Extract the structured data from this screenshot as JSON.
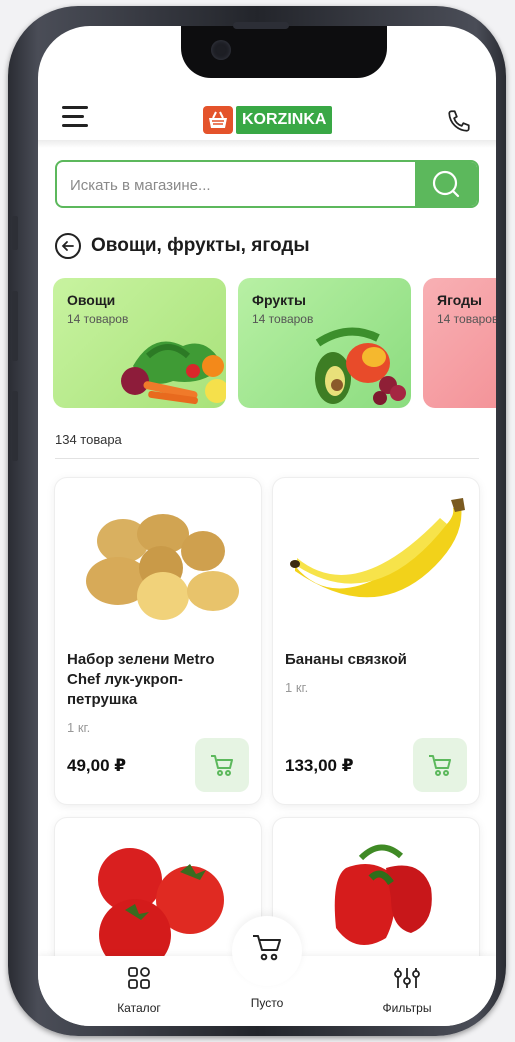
{
  "header": {
    "logo_text": "KORZINKA"
  },
  "search": {
    "placeholder": "Искать в магазине..."
  },
  "breadcrumb": {
    "title": "Овощи, фрукты, ягоды"
  },
  "categories": [
    {
      "name": "Овощи",
      "count": "14 товаров",
      "color": "#b9ee8c"
    },
    {
      "name": "Фрукты",
      "count": "14 товаров",
      "color": "#9be68f"
    },
    {
      "name": "Ягоды",
      "count": "14 товаров",
      "color": "#f6a1a5"
    }
  ],
  "products_count": "134 товара",
  "products": [
    {
      "name": "Набор зелени Metro Chef лук-укроп-петрушка",
      "unit": "1 кг.",
      "price": "49,00 ₽",
      "image": "potato"
    },
    {
      "name": "Бананы связкой",
      "unit": "1 кг.",
      "price": "133,00 ₽",
      "image": "banana"
    },
    {
      "name": "",
      "unit": "",
      "price": "",
      "image": "tomato"
    },
    {
      "name": "",
      "unit": "",
      "price": "",
      "image": "pepper"
    }
  ],
  "tabbar": {
    "catalog": "Каталог",
    "cart": "Пусто",
    "filters": "Фильтры"
  },
  "colors": {
    "accent": "#5cb85c",
    "logo_red": "#e4532b",
    "logo_green": "#39a845"
  }
}
